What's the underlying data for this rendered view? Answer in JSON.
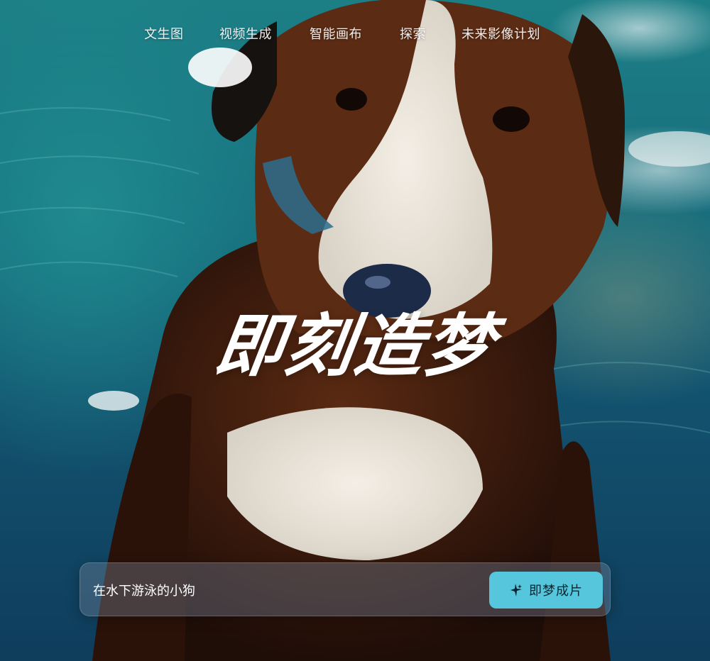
{
  "nav": {
    "items": [
      {
        "label": "文生图"
      },
      {
        "label": "视频生成"
      },
      {
        "label": "智能画布"
      },
      {
        "label": "探索"
      },
      {
        "label": "未来影像计划"
      }
    ]
  },
  "hero": {
    "headline": "即刻造梦",
    "image_subject": "dog-swimming-underwater"
  },
  "prompt": {
    "value": "在水下游泳的小狗",
    "button_label": "即梦成片",
    "button_icon": "sparkle-icon"
  },
  "colors": {
    "accent": "#55c6dc",
    "water_dark": "#0f3d5c",
    "water_light": "#1d7f86"
  }
}
